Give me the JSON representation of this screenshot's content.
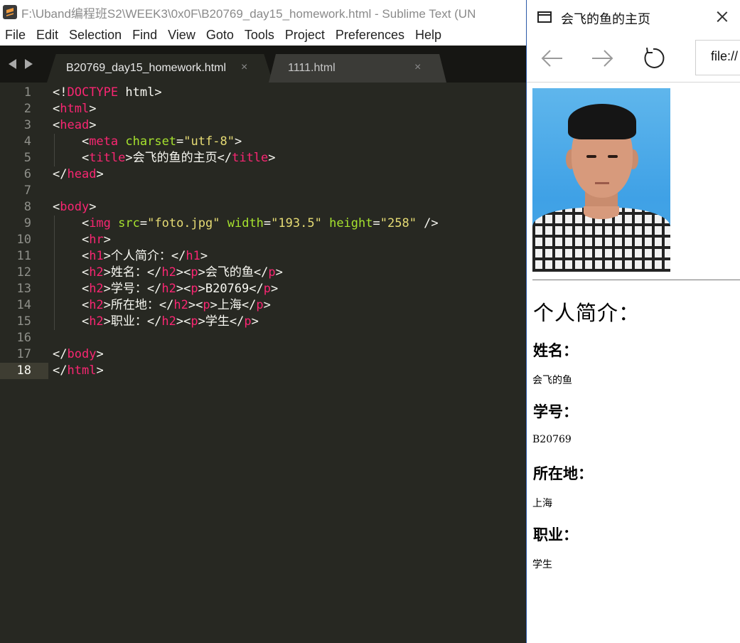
{
  "sublime": {
    "window_title": "F:\\Uband编程班S2\\WEEK3\\0x0F\\B20769_day15_homework.html - Sublime Text (UN",
    "menu": [
      "File",
      "Edit",
      "Selection",
      "Find",
      "View",
      "Goto",
      "Tools",
      "Project",
      "Preferences",
      "Help"
    ],
    "tabs": [
      {
        "label": "B20769_day15_homework.html",
        "close": "×",
        "active": true
      },
      {
        "label": "1111.html",
        "close": "×",
        "active": false
      }
    ],
    "current_line": 18,
    "line_numbers": [
      "1",
      "2",
      "3",
      "4",
      "5",
      "6",
      "7",
      "8",
      "9",
      "10",
      "11",
      "12",
      "13",
      "14",
      "15",
      "16",
      "17",
      "18"
    ],
    "code": [
      [
        [
          "w",
          "<!"
        ],
        [
          "t",
          "DOCTYPE"
        ],
        [
          "w",
          " html>"
        ]
      ],
      [
        [
          "w",
          "<"
        ],
        [
          "t",
          "html"
        ],
        [
          "w",
          ">"
        ]
      ],
      [
        [
          "w",
          "<"
        ],
        [
          "t",
          "head"
        ],
        [
          "w",
          ">"
        ]
      ],
      [
        [
          "w",
          "    <"
        ],
        [
          "t",
          "meta"
        ],
        [
          "w",
          " "
        ],
        [
          "a",
          "charset"
        ],
        [
          "w",
          "="
        ],
        [
          "s",
          "\"utf-8\""
        ],
        [
          "w",
          ">"
        ]
      ],
      [
        [
          "w",
          "    <"
        ],
        [
          "t",
          "title"
        ],
        [
          "w",
          ">会飞的鱼的主页</"
        ],
        [
          "t",
          "title"
        ],
        [
          "w",
          ">"
        ]
      ],
      [
        [
          "w",
          "</"
        ],
        [
          "t",
          "head"
        ],
        [
          "w",
          ">"
        ]
      ],
      [],
      [
        [
          "w",
          "<"
        ],
        [
          "t",
          "body"
        ],
        [
          "w",
          ">"
        ]
      ],
      [
        [
          "w",
          "    <"
        ],
        [
          "t",
          "img"
        ],
        [
          "w",
          " "
        ],
        [
          "a",
          "src"
        ],
        [
          "w",
          "="
        ],
        [
          "s",
          "\"foto.jpg\""
        ],
        [
          "w",
          " "
        ],
        [
          "a",
          "width"
        ],
        [
          "w",
          "="
        ],
        [
          "s",
          "\"193.5\""
        ],
        [
          "w",
          " "
        ],
        [
          "a",
          "height"
        ],
        [
          "w",
          "="
        ],
        [
          "s",
          "\"258\""
        ],
        [
          "w",
          " />"
        ]
      ],
      [
        [
          "w",
          "    <"
        ],
        [
          "t",
          "hr"
        ],
        [
          "w",
          ">"
        ]
      ],
      [
        [
          "w",
          "    <"
        ],
        [
          "t",
          "h1"
        ],
        [
          "w",
          ">个人简介：</"
        ],
        [
          "t",
          "h1"
        ],
        [
          "w",
          ">"
        ]
      ],
      [
        [
          "w",
          "    <"
        ],
        [
          "t",
          "h2"
        ],
        [
          "w",
          ">姓名：</"
        ],
        [
          "t",
          "h2"
        ],
        [
          "w",
          "><"
        ],
        [
          "t",
          "p"
        ],
        [
          "w",
          ">会飞的鱼</"
        ],
        [
          "t",
          "p"
        ],
        [
          "w",
          ">"
        ]
      ],
      [
        [
          "w",
          "    <"
        ],
        [
          "t",
          "h2"
        ],
        [
          "w",
          ">学号：</"
        ],
        [
          "t",
          "h2"
        ],
        [
          "w",
          "><"
        ],
        [
          "t",
          "p"
        ],
        [
          "w",
          ">B20769</"
        ],
        [
          "t",
          "p"
        ],
        [
          "w",
          ">"
        ]
      ],
      [
        [
          "w",
          "    <"
        ],
        [
          "t",
          "h2"
        ],
        [
          "w",
          ">所在地：</"
        ],
        [
          "t",
          "h2"
        ],
        [
          "w",
          "><"
        ],
        [
          "t",
          "p"
        ],
        [
          "w",
          ">上海</"
        ],
        [
          "t",
          "p"
        ],
        [
          "w",
          ">"
        ]
      ],
      [
        [
          "w",
          "    <"
        ],
        [
          "t",
          "h2"
        ],
        [
          "w",
          ">职业：</"
        ],
        [
          "t",
          "h2"
        ],
        [
          "w",
          "><"
        ],
        [
          "t",
          "p"
        ],
        [
          "w",
          ">学生</"
        ],
        [
          "t",
          "p"
        ],
        [
          "w",
          ">"
        ]
      ],
      [],
      [
        [
          "w",
          "</"
        ],
        [
          "t",
          "body"
        ],
        [
          "w",
          ">"
        ]
      ],
      [
        [
          "w",
          "</"
        ],
        [
          "t",
          "html"
        ],
        [
          "w",
          ">"
        ]
      ]
    ],
    "colors": {
      "background": "#272822",
      "tag": "#f92672",
      "attribute": "#a6e22e",
      "string": "#e6db74",
      "text": "#f8f8f2",
      "gutter": "#8f908a"
    }
  },
  "browser": {
    "title": "会飞的鱼的主页",
    "address": "file://",
    "icons": {
      "window": "window-icon",
      "close": "close-icon",
      "back": "back-arrow-icon",
      "forward": "forward-arrow-icon",
      "refresh": "refresh-icon"
    },
    "page": {
      "h1": "个人简介：",
      "sections": [
        {
          "heading": "姓名：",
          "value": "会飞的鱼"
        },
        {
          "heading": "学号：",
          "value": "B20769"
        },
        {
          "heading": "所在地：",
          "value": "上海"
        },
        {
          "heading": "职业：",
          "value": "学生"
        }
      ]
    }
  }
}
